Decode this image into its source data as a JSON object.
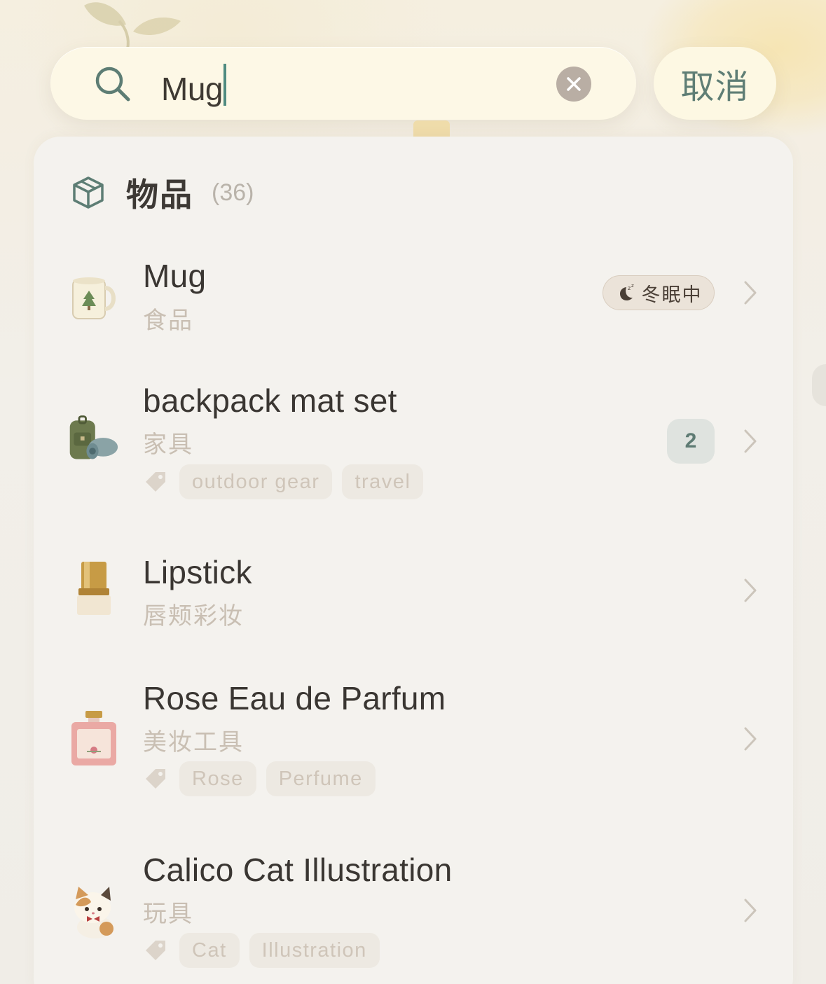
{
  "search": {
    "query": "Mug",
    "cancel_label": "取消"
  },
  "section": {
    "title": "物品",
    "count": "(36)"
  },
  "items": [
    {
      "name": "Mug",
      "category": "食品",
      "thumb_icon": "mug-icon",
      "status_badge": "冬眠中",
      "tags": []
    },
    {
      "name": "backpack mat set",
      "category": "家具",
      "thumb_icon": "backpack-icon",
      "count_badge": "2",
      "tags": [
        "outdoor gear",
        "travel"
      ]
    },
    {
      "name": "Lipstick",
      "category": "唇颊彩妆",
      "thumb_icon": "lipstick-icon",
      "tags": []
    },
    {
      "name": "Rose Eau de Parfum",
      "category": "美妆工具",
      "thumb_icon": "perfume-icon",
      "tags": [
        "Rose",
        "Perfume"
      ]
    },
    {
      "name": "Calico Cat Illustration",
      "category": "玩具",
      "thumb_icon": "cat-icon",
      "tags": [
        "Cat",
        "Illustration"
      ]
    }
  ],
  "colors": {
    "accent": "#5f7e75",
    "caret": "#4f8b80",
    "search_bg": "#fdf8e6",
    "panel_bg": "#f4f2ee",
    "category_text": "#c9bfb3",
    "tag_text": "#cfc5b9"
  }
}
